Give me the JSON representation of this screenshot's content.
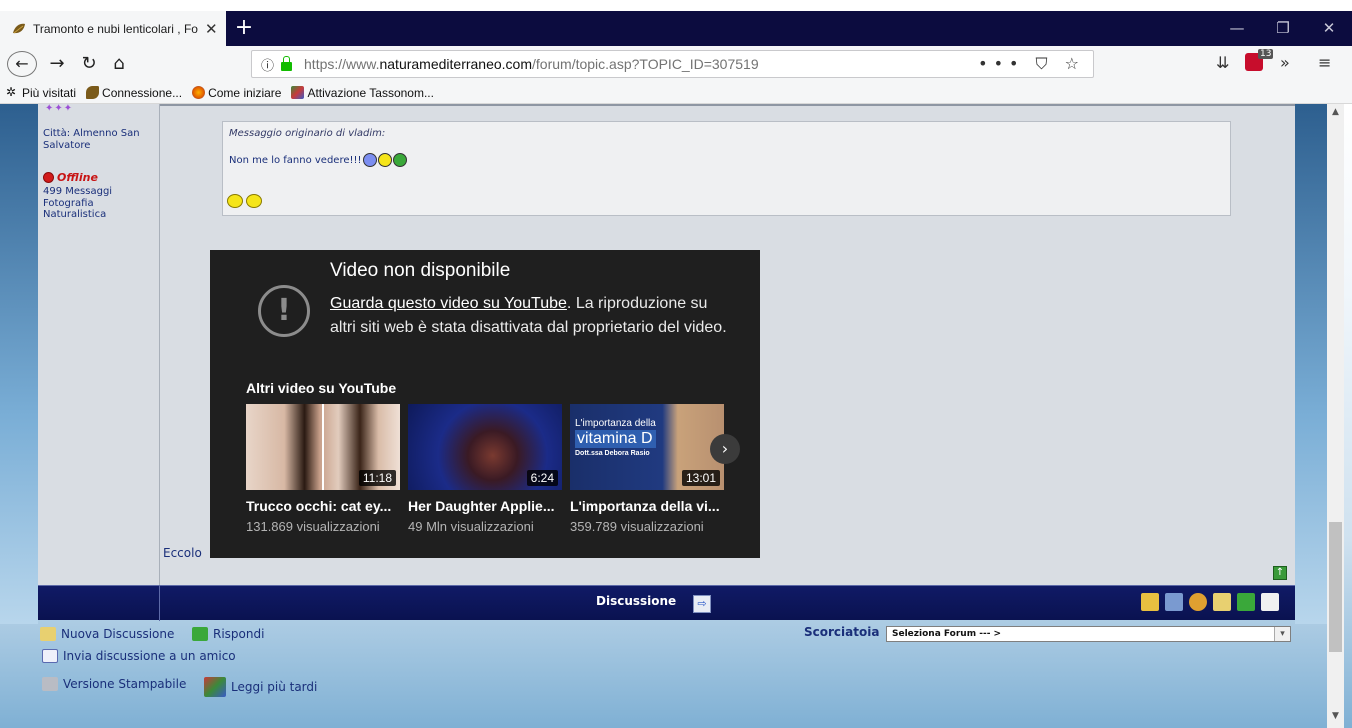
{
  "browser": {
    "tab_title": "Tramonto e nubi lenticolari , Fo",
    "tab_close": "✕",
    "new_tab": "+",
    "win_minimize": "—",
    "win_restore": "❐",
    "win_close": "✕",
    "url_prefix": "https://www.",
    "url_domain": "naturamediterraneo.com",
    "url_path": "/forum/topic.asp?TOPIC_ID=307519",
    "url_actions": "••• ⛉ ☆",
    "bookmarks": [
      {
        "label": "Più visitati",
        "icon": "gear-icon"
      },
      {
        "label": "Connessione...",
        "icon": "leaf-icon"
      },
      {
        "label": "Come iniziare",
        "icon": "firefox-icon"
      },
      {
        "label": "Attivazione Tassonom...",
        "icon": "grid-icon"
      }
    ],
    "abp_badge": "13"
  },
  "user": {
    "city": "Città: Almenno San Salvatore",
    "status": "Offline",
    "info": "499 Messaggi Fotografia Naturalistica"
  },
  "quote": {
    "header": "Messaggio originario di vladim:",
    "text": "Non me lo fanno vedere!!!"
  },
  "youtube": {
    "title": "Video non disponibile",
    "link": "Guarda questo video su YouTube",
    "message": ". La riproduzione su altri siti web è stata disattivata dal proprietario del video.",
    "more_label": "Altri video su YouTube",
    "videos": [
      {
        "title": "Trucco occhi: cat ey...",
        "views": "131.869 visualizzazioni",
        "duration": "11:18"
      },
      {
        "title": "Her Daughter Applie...",
        "views": "49 Mln visualizzazioni",
        "duration": "6:24"
      },
      {
        "title": "L'importanza della vi...",
        "views": "359.789 visualizzazioni",
        "duration": "13:01"
      }
    ],
    "thumb3": {
      "line1": "L'importanza della",
      "line2": "vitamina D",
      "line3": "Dott.ssa Debora Rasio"
    }
  },
  "post": {
    "trailing_text": "Eccolo"
  },
  "discussion_bar": {
    "label": "Discussione"
  },
  "footer": {
    "new_topic": "Nuova Discussione",
    "reply": "Rispondi",
    "send_friend": "Invia discussione a un amico",
    "printable": "Versione Stampabile",
    "read_later": "Leggi più tardi",
    "shortcut_label": "Scorciatoia",
    "shortcut_select": "Seleziona Forum --- >"
  }
}
